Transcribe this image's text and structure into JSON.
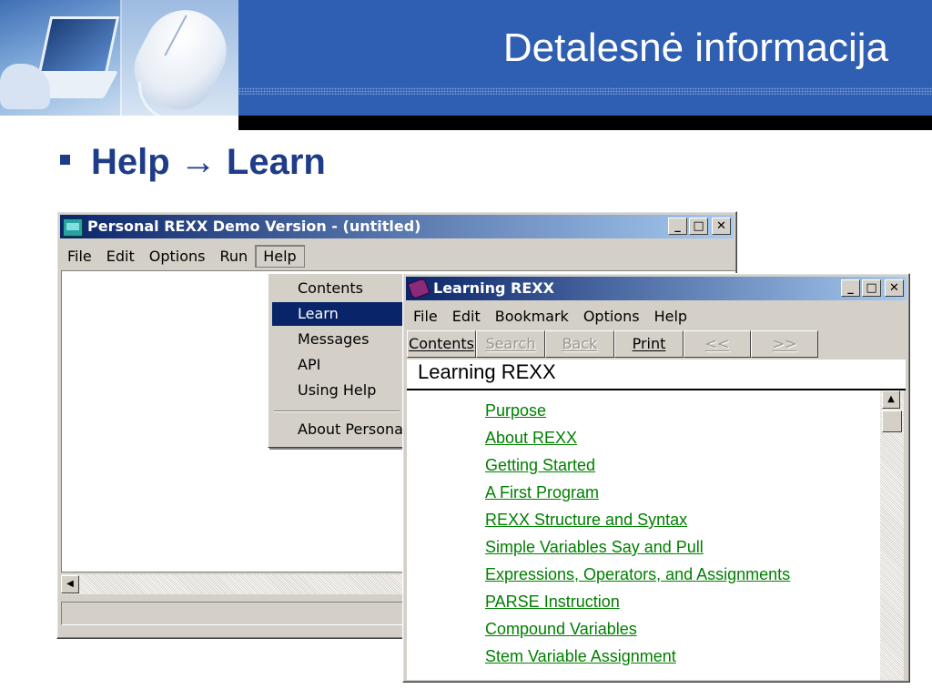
{
  "slide": {
    "title": "Detalesnė informacija",
    "bullet": "Help → Learn"
  },
  "main_window": {
    "title": "Personal REXX Demo Version - (untitled)",
    "menu": [
      "File",
      "Edit",
      "Options",
      "Run",
      "Help"
    ]
  },
  "help_menu": {
    "items": [
      "Contents",
      "Learn",
      "Messages",
      "API",
      "Using Help",
      "About Persona"
    ],
    "selected": "Learn"
  },
  "help_window": {
    "title": "Learning REXX",
    "menu": [
      "File",
      "Edit",
      "Bookmark",
      "Options",
      "Help"
    ],
    "toolbar": [
      "Contents",
      "Search",
      "Back",
      "Print",
      "<<",
      ">>"
    ],
    "topic_heading": "Learning REXX",
    "links": [
      "Purpose",
      "About REXX",
      "Getting Started",
      "A First Program",
      "REXX Structure and Syntax",
      "Simple Variables Say and Pull",
      "Expressions, Operators, and Assignments",
      "PARSE Instruction",
      "Compound Variables",
      "Stem Variable Assignment"
    ]
  },
  "caption_buttons": {
    "minimize": "_",
    "maximize": "□",
    "close": "✕"
  },
  "colors": {
    "accent": "#2f5fb3",
    "link": "#008000",
    "titlebar": "#0a246a"
  }
}
